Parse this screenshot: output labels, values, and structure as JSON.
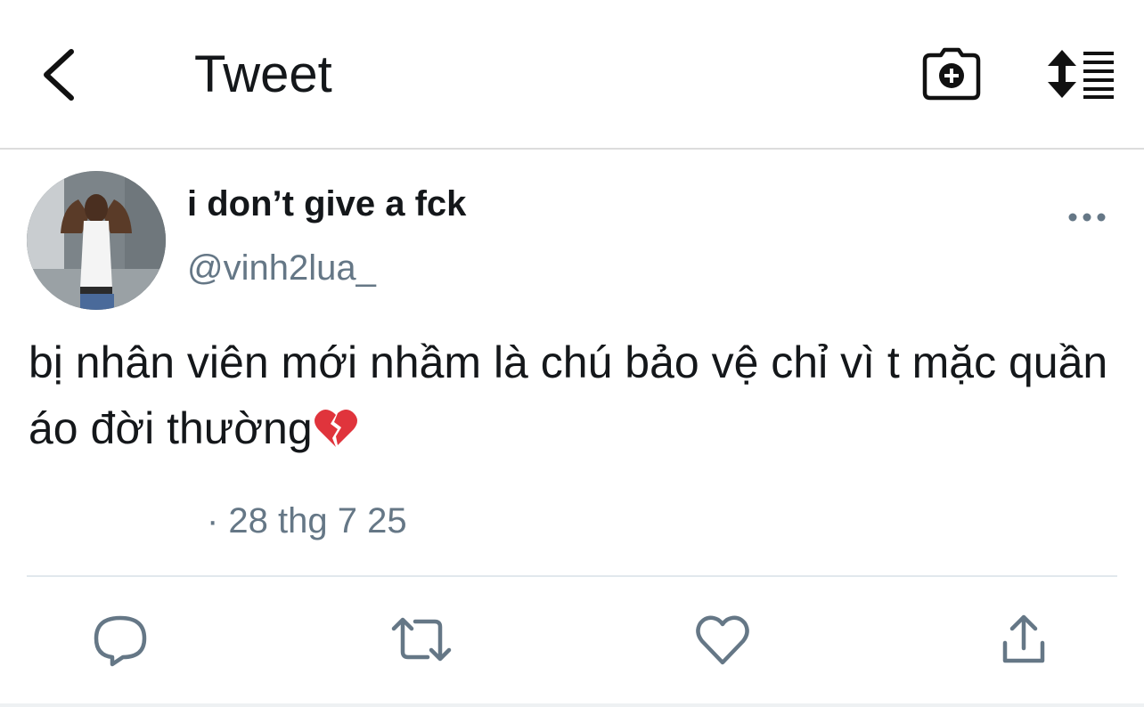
{
  "header": {
    "title": "Tweet",
    "back_icon": "chevron-left-icon",
    "camera_icon": "camera-plus-icon",
    "sort_icon": "sort-list-icon"
  },
  "tweet": {
    "display_name": "i don’t give a fck",
    "handle": "@vinh2lua_",
    "text": "bị nhân viên mới nhầm là chú bảo vệ chỉ vì t mặc quần áo đời thường",
    "emoji": "broken-heart-emoji",
    "meta": "· 28 thg 7 25"
  },
  "actions": {
    "reply_icon": "reply-icon",
    "retweet_icon": "retweet-icon",
    "like_icon": "heart-icon",
    "share_icon": "share-icon"
  },
  "colors": {
    "text": "#14171a",
    "secondary": "#657786",
    "icon": "#657786",
    "divider": "#e1e8ed",
    "heart_emoji": "#e0343c"
  }
}
